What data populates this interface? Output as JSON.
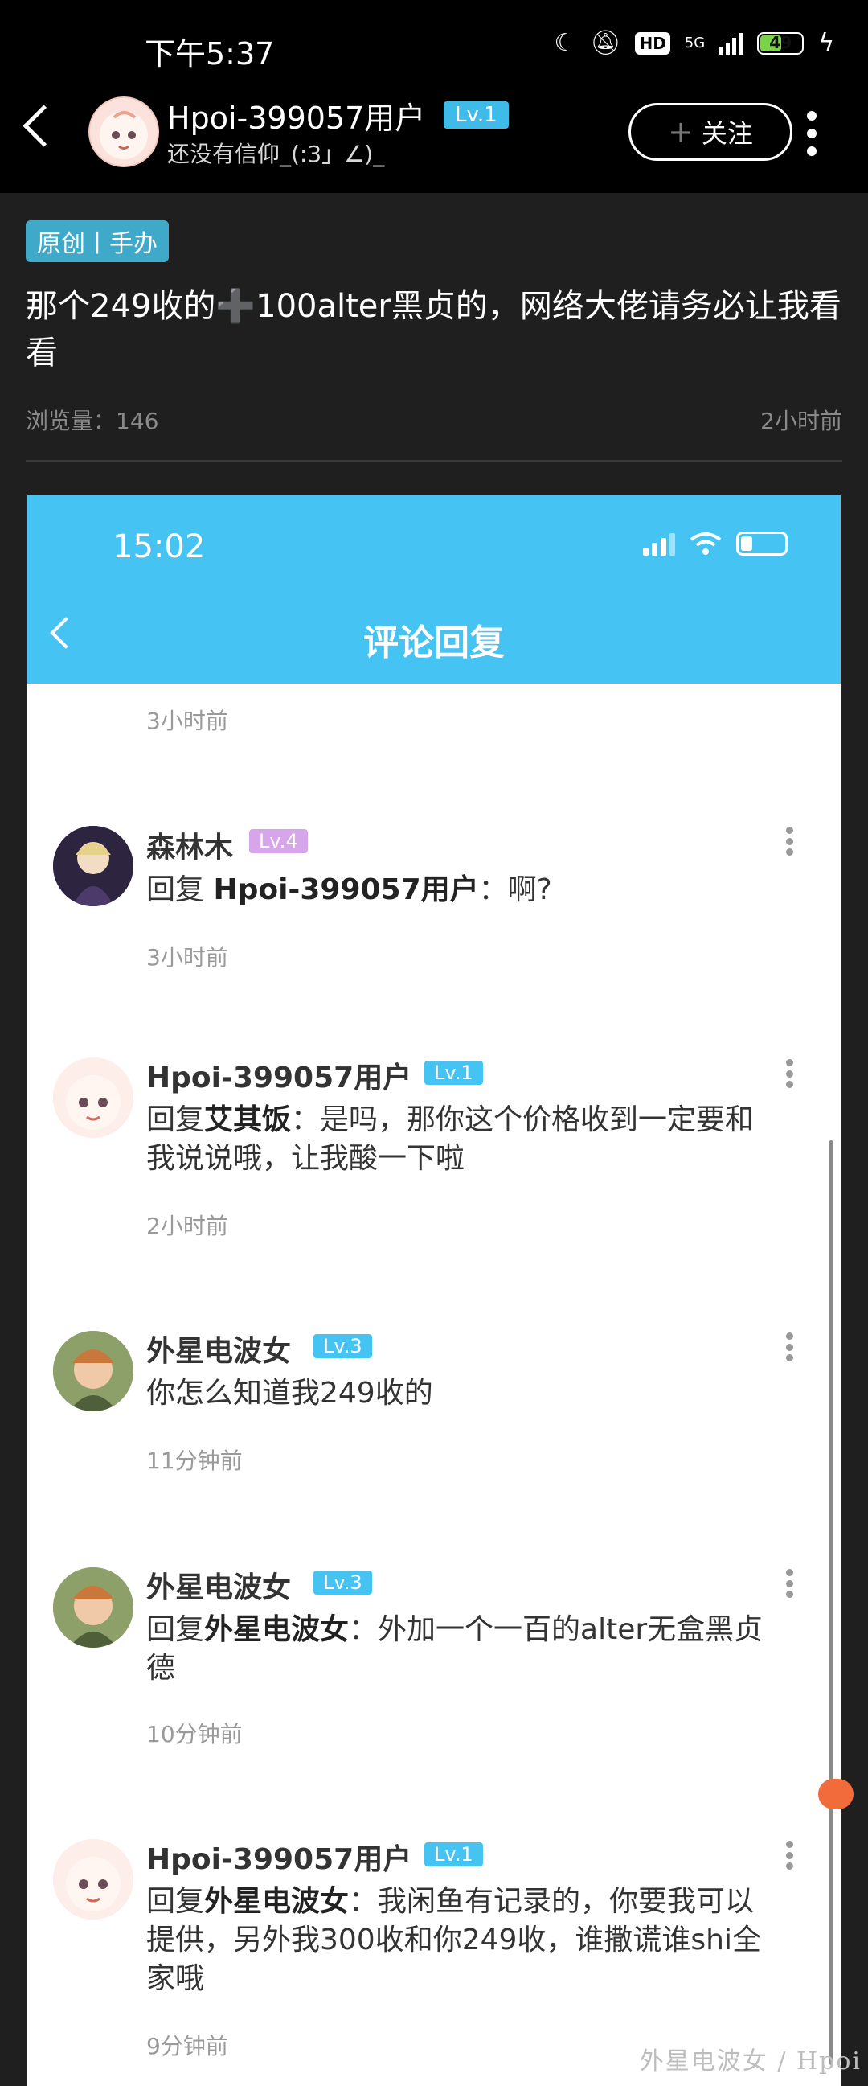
{
  "status_bar": {
    "time": "下午5:37",
    "network": "5G",
    "hd": "HD",
    "battery": "49"
  },
  "header": {
    "username": "Hpoi-399057用户",
    "level": "Lv.1",
    "subtitle": "还没有信仰_(:3」∠)_",
    "follow_label": "关注",
    "follow_icon": "plus-icon"
  },
  "post": {
    "tag": "原创丨手办",
    "title": "那个249收的➕100alter黑贞的，网络大佬请务必让我看看",
    "views": "浏览量：146",
    "time": "2小时前"
  },
  "screenshot": {
    "status_time": "15:02",
    "title": "评论回复",
    "top_time": "3小时前",
    "comments": [
      {
        "name": "森林木",
        "level": "Lv.4",
        "level_color": "#d7a6ea",
        "reply_prefix": "回复 ",
        "reply_target": "Hpoi-399057用户",
        "text": "：啊?",
        "time": "3小时前"
      },
      {
        "name": "Hpoi-399057用户",
        "level": "Lv.1",
        "level_color": "#45c3f3",
        "reply_prefix": "回复",
        "reply_target": "艾其饭",
        "text": "：是吗，那你这个价格收到一定要和我说说哦，让我酸一下啦",
        "time": "2小时前"
      },
      {
        "name": "外星电波女",
        "level": "Lv.3",
        "level_color": "#45c3f3",
        "reply_prefix": "",
        "reply_target": "",
        "text": "你怎么知道我249收的",
        "time": "11分钟前"
      },
      {
        "name": "外星电波女",
        "level": "Lv.3",
        "level_color": "#45c3f3",
        "reply_prefix": "回复",
        "reply_target": "外星电波女",
        "text": "：外加一个一百的alter无盒黑贞德",
        "time": "10分钟前"
      },
      {
        "name": "Hpoi-399057用户",
        "level": "Lv.1",
        "level_color": "#45c3f3",
        "reply_prefix": "回复",
        "reply_target": "外星电波女",
        "text": "：我闲鱼有记录的，你要我可以提供，另外我300收和你249收，谁撒谎谁shi全家哦",
        "time": "9分钟前"
      }
    ]
  },
  "watermark": "外星电波女 / Hpoi"
}
